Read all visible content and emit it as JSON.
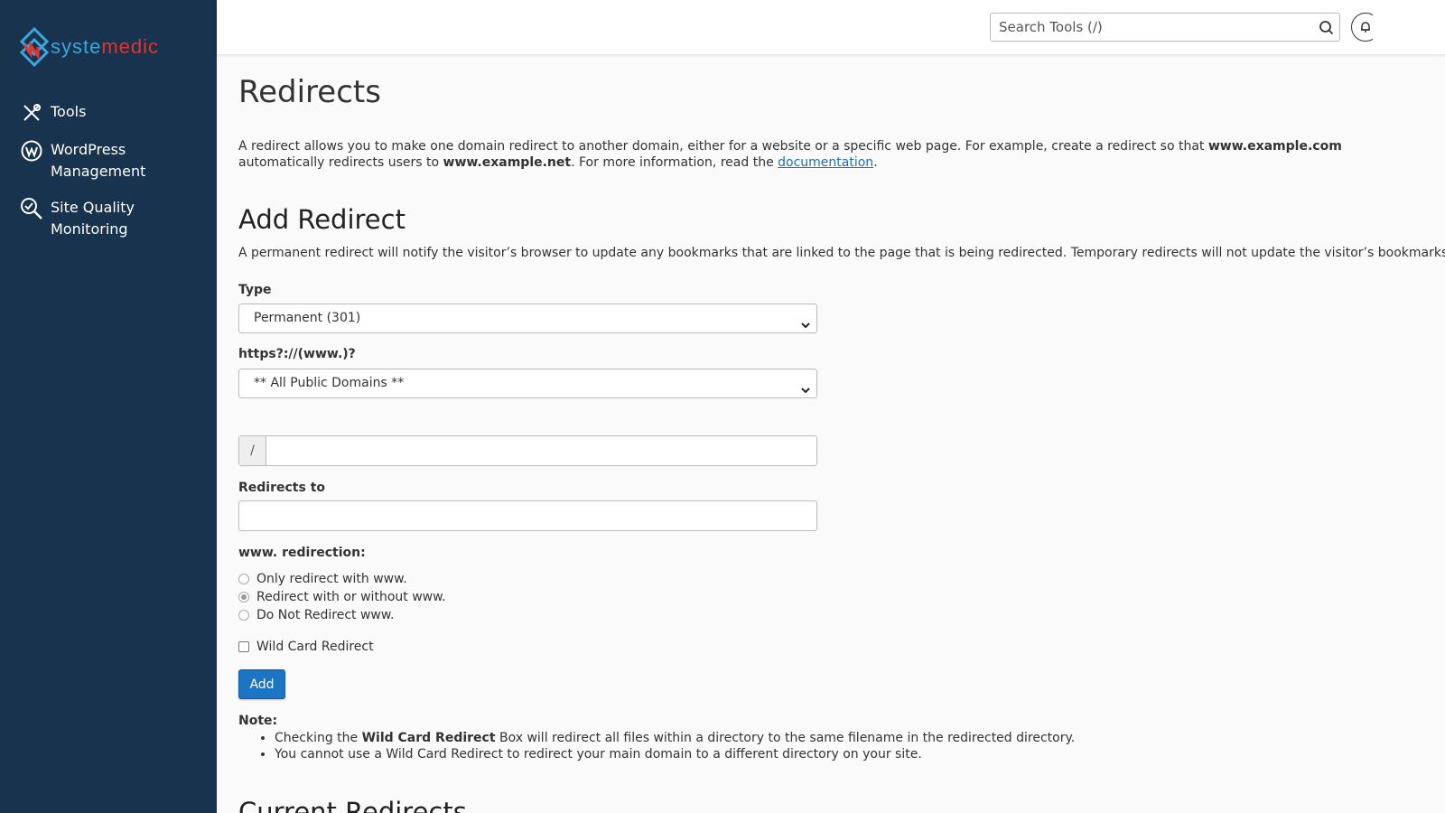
{
  "logo": {
    "part1": "syste",
    "part2": "medic"
  },
  "sidebar": {
    "items": [
      {
        "label": "Tools"
      },
      {
        "label": "WordPress Management"
      },
      {
        "label": "Site Quality Monitoring"
      }
    ]
  },
  "topbar": {
    "search_placeholder": "Search Tools (/)"
  },
  "page": {
    "title": "Redirects",
    "intro": {
      "t1": "A redirect allows you to make one domain redirect to another domain, either for a website or a specific web page. For example, create a redirect so that ",
      "b1": "www.example.com",
      "t2": " automatically redirects users to ",
      "b2": "www.example.net",
      "t3": ". For more information, read the ",
      "link": "documentation",
      "t4": "."
    }
  },
  "add_redirect": {
    "title": "Add Redirect",
    "description": "A permanent redirect will notify the visitor’s browser to update any bookmarks that are linked to the page that is being redirected. Temporary redirects will not update the visitor’s bookmarks.",
    "type_label": "Type",
    "type_value": "Permanent (301)",
    "domain_label": "https?://(www.)?",
    "domain_value": "** All Public Domains **",
    "path_prefix": "/",
    "path_value": "",
    "redirects_to_label": "Redirects to",
    "redirects_to_value": "",
    "www_label": "www. redirection:",
    "www_options": [
      {
        "label": "Only redirect with www.",
        "checked": false
      },
      {
        "label": "Redirect with or without www.",
        "checked": true
      },
      {
        "label": "Do Not Redirect www.",
        "checked": false
      }
    ],
    "wildcard_label": "Wild Card Redirect",
    "add_button": "Add"
  },
  "note": {
    "label": "Note:",
    "item1_pre": "Checking the ",
    "item1_bold": "Wild Card Redirect",
    "item1_post": " Box will redirect all files within a directory to the same filename in the redirected directory.",
    "item2": "You cannot use a Wild Card Redirect to redirect your main domain to a different directory on your site."
  },
  "current_redirects": {
    "title": "Current Redirects"
  },
  "colors": {
    "sidebar": "#17334e",
    "accent": "#1c74c4",
    "logo_blue": "#39a7e0",
    "logo_red": "#e5322d",
    "link": "#1f6fb3"
  }
}
